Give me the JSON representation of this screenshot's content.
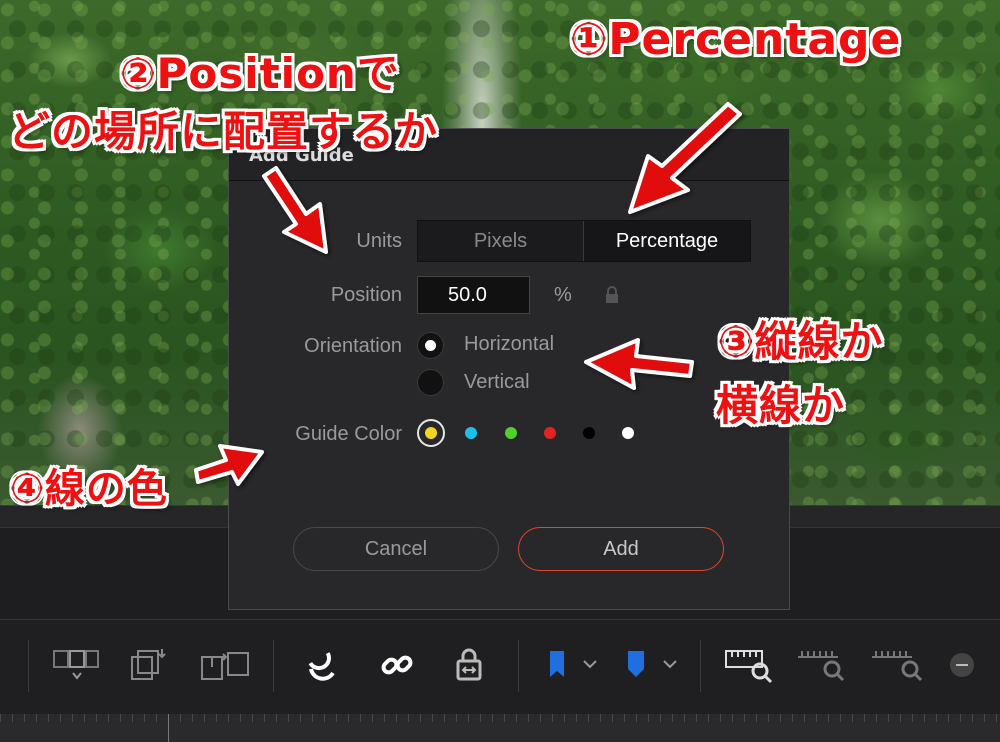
{
  "dialog": {
    "title": "Add Guide",
    "units_label": "Units",
    "units_options": [
      "Pixels",
      "Percentage"
    ],
    "units_selected": "Percentage",
    "position_label": "Position",
    "position_value": "50.0",
    "position_unit": "%",
    "orientation_label": "Orientation",
    "orientation_options": [
      "Horizontal",
      "Vertical"
    ],
    "orientation_selected": "Horizontal",
    "guide_color_label": "Guide Color",
    "guide_colors": [
      "#f5d41f",
      "#1fc0e8",
      "#4fd12b",
      "#e32222",
      "#000000",
      "#ffffff"
    ],
    "guide_color_selected": "#f5d41f",
    "cancel_label": "Cancel",
    "add_label": "Add"
  },
  "annotations": {
    "a1": "①Percentage",
    "a2_line1": "②Positionで",
    "a2_line2": "どの場所に配置するか",
    "a3_line1": "③縦線か",
    "a3_line2": "横線か",
    "a4": "④線の色"
  },
  "toolbar": {
    "icons": [
      "overwrite-clip-icon",
      "replace-clip-icon",
      "swap-clip-icon",
      "snapping-icon",
      "linked-selection-icon",
      "position-lock-icon",
      "flag-icon",
      "marker-icon",
      "zoom-full-icon",
      "zoom-detail-icon",
      "zoom-custom-icon",
      "zoom-out-icon"
    ]
  },
  "colors": {
    "accent_add_border": "#e1472a",
    "annotation_red": "#e11111",
    "marker_blue": "#1f6fe0"
  }
}
